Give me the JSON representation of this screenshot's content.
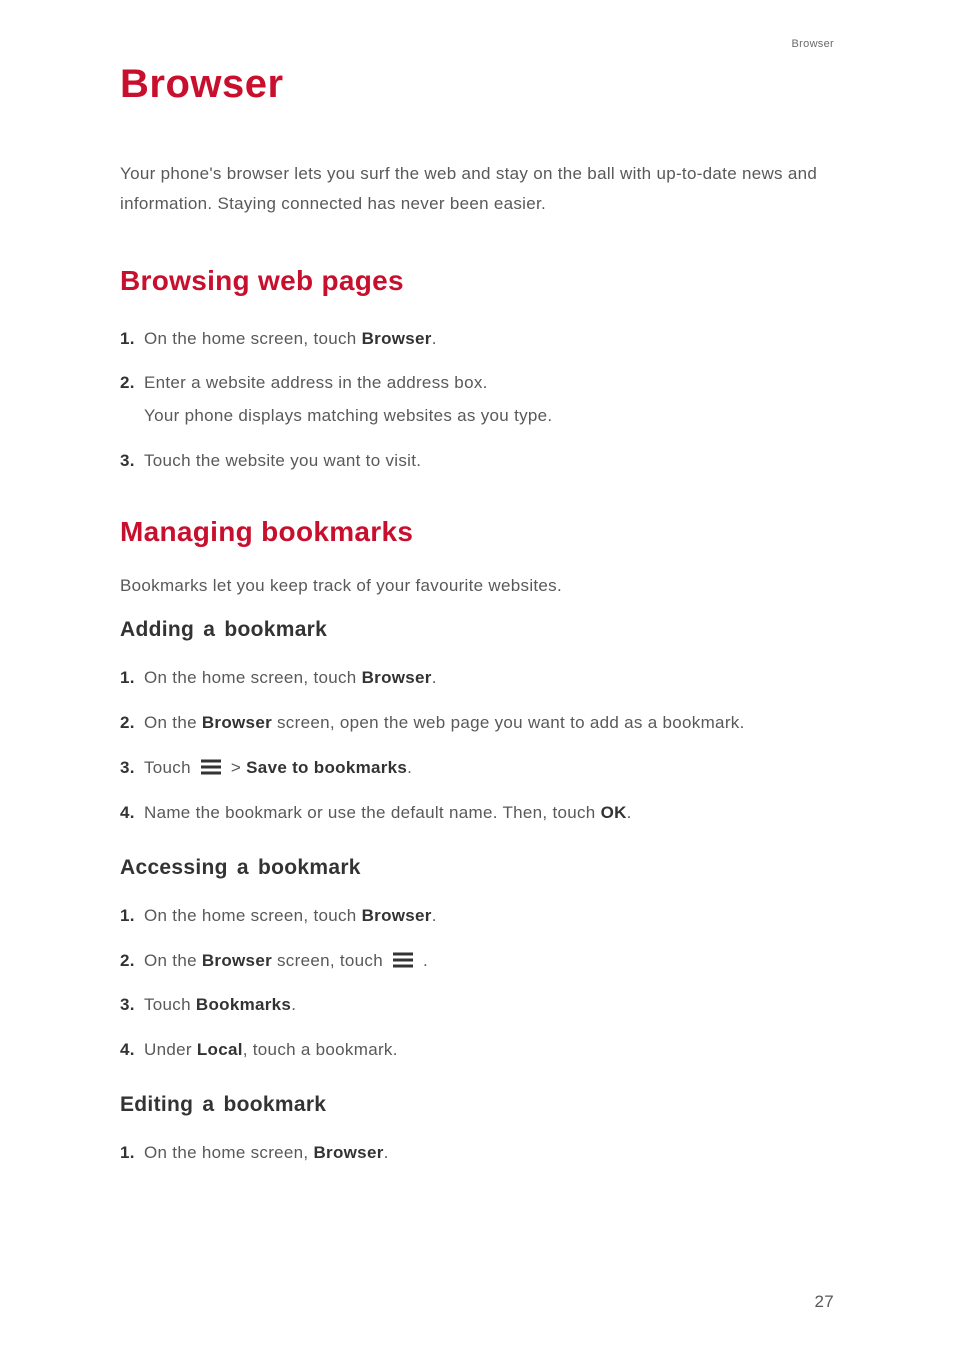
{
  "header": {
    "section": "Browser"
  },
  "title": "Browser",
  "intro": "Your phone's browser lets you surf the web and stay on the ball with up-to-date news and information. Staying connected has never been easier.",
  "h2a": "Browsing web pages",
  "listA": {
    "m1": "1.",
    "t1a": "On the home screen, touch ",
    "t1b": "Browser",
    "t1c": ".",
    "m2": "2.",
    "t2a": "Enter a website address in the address box.",
    "t2b": "Your phone displays matching websites as you type.",
    "m3": "3.",
    "t3a": "Touch the website you want to visit."
  },
  "h2b": "Managing bookmarks",
  "pB": "Bookmarks let you keep track of your favourite websites.",
  "h3a": "Adding a bookmark",
  "listB": {
    "m1": "1.",
    "t1a": "On the home screen, touch ",
    "t1b": "Browser",
    "t1c": ".",
    "m2": "2.",
    "t2a": "On the ",
    "t2b": "Browser",
    "t2c": " screen, open the web page you want to add as a bookmark.",
    "m3": "3.",
    "t3a": "Touch ",
    "t3b": " > ",
    "t3c": "Save to bookmarks",
    "t3d": ".",
    "m4": "4.",
    "t4a": "Name the bookmark or use the default name. Then, touch ",
    "t4b": "OK",
    "t4c": "."
  },
  "h3b": "Accessing a bookmark",
  "listC": {
    "m1": "1.",
    "t1a": "On the home screen, touch ",
    "t1b": "Browser",
    "t1c": ".",
    "m2": "2.",
    "t2a": "On the ",
    "t2b": "Browser",
    "t2c": " screen, touch ",
    "t2d": " .",
    "m3": "3.",
    "t3a": "Touch ",
    "t3b": "Bookmarks",
    "t3c": ".",
    "m4": "4.",
    "t4a": "Under ",
    "t4b": "Local",
    "t4c": ", touch a bookmark."
  },
  "h3c": "Editing a bookmark",
  "listD": {
    "m1": "1.",
    "t1a": "On the home screen, ",
    "t1b": "Browser",
    "t1c": "."
  },
  "pageNumber": "27"
}
